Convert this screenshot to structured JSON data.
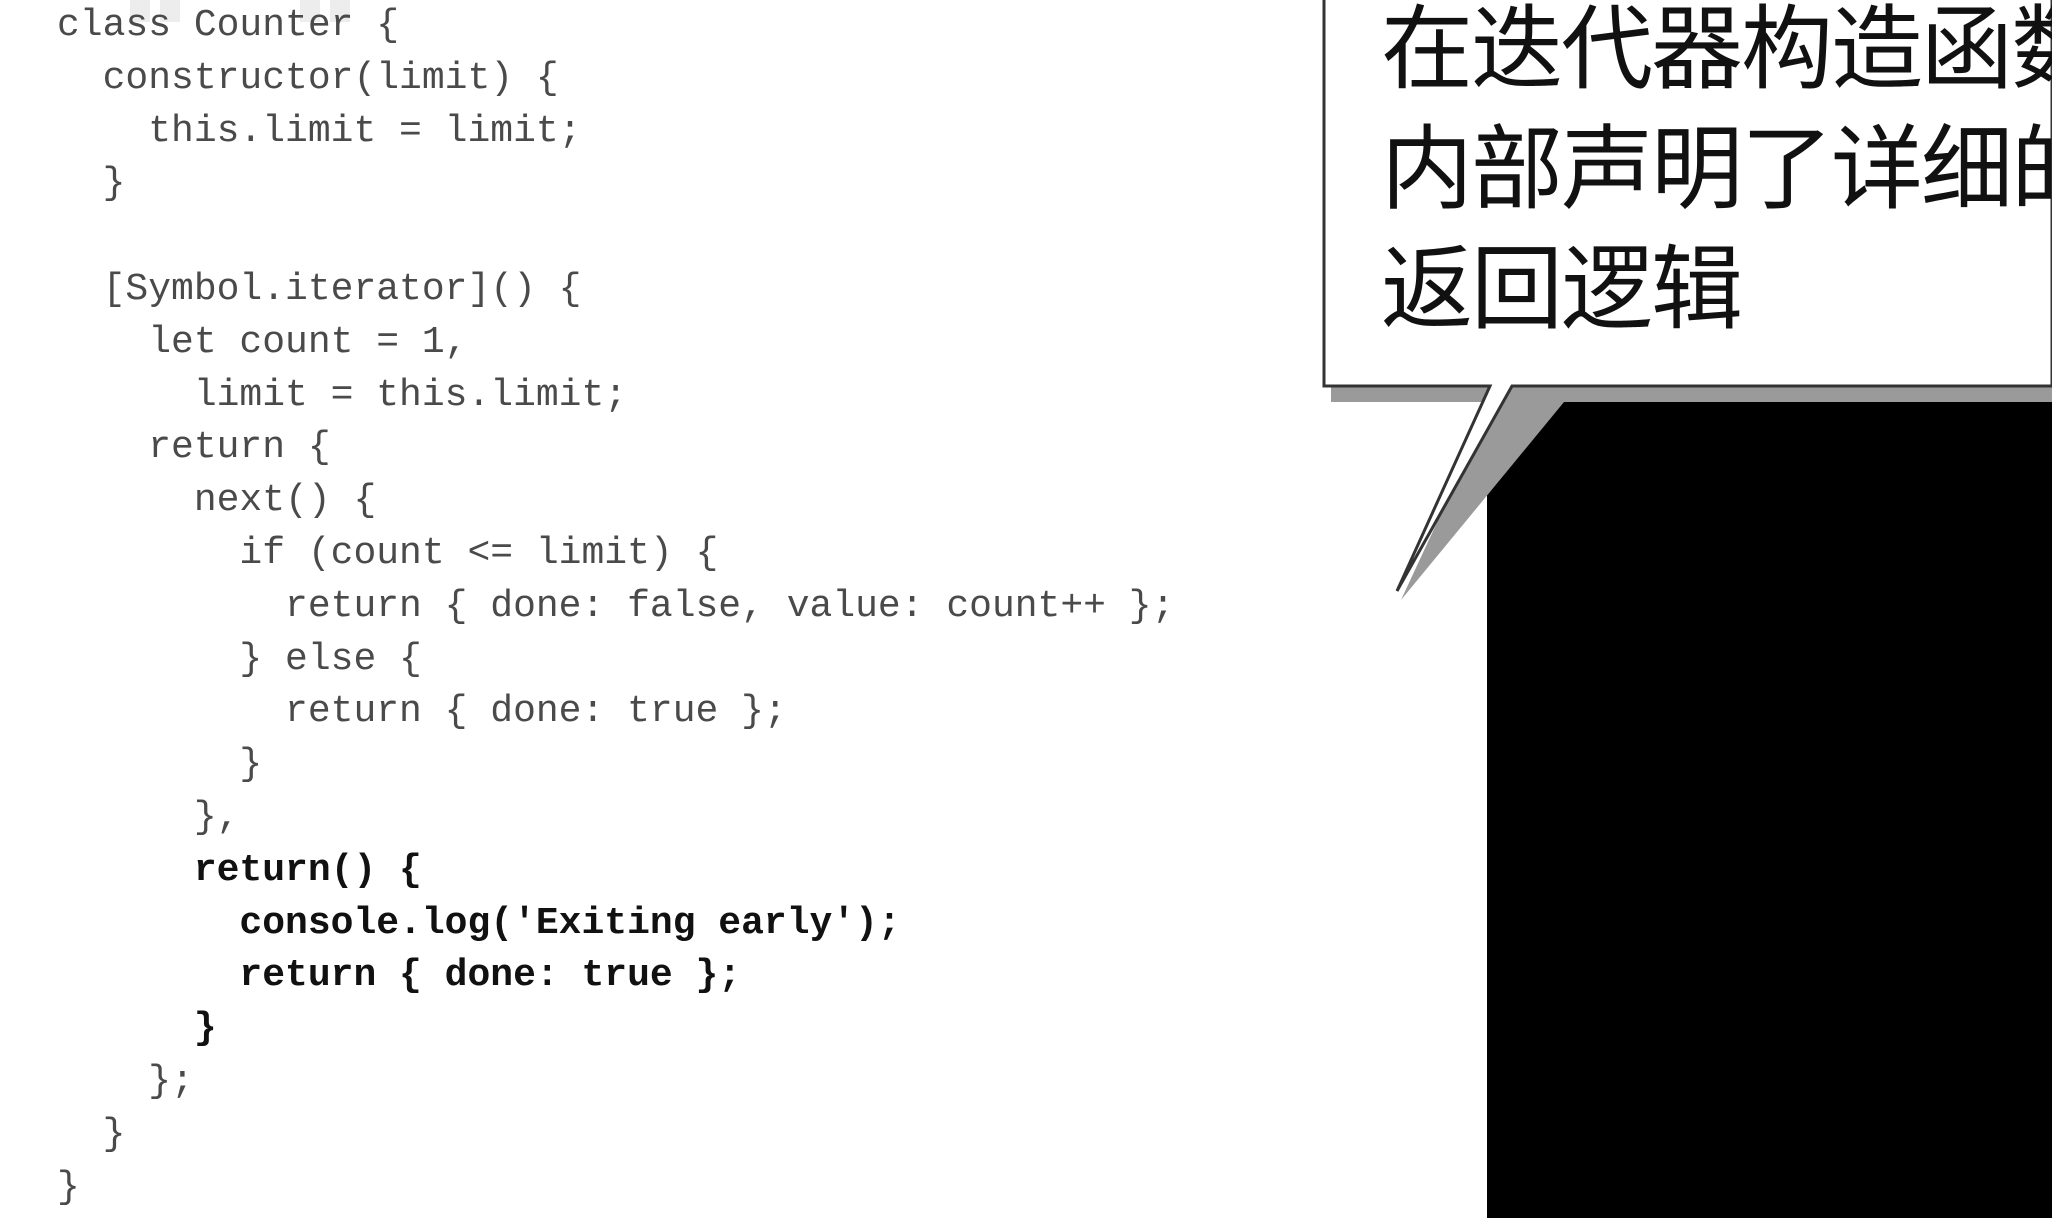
{
  "code": {
    "lines": [
      {
        "text": "class Counter {",
        "bold": false
      },
      {
        "text": "  constructor(limit) {",
        "bold": false
      },
      {
        "text": "    this.limit = limit;",
        "bold": false
      },
      {
        "text": "  }",
        "bold": false
      },
      {
        "text": "",
        "bold": false
      },
      {
        "text": "  [Symbol.iterator]() {",
        "bold": false
      },
      {
        "text": "    let count = 1,",
        "bold": false
      },
      {
        "text": "      limit = this.limit;",
        "bold": false
      },
      {
        "text": "    return {",
        "bold": false
      },
      {
        "text": "      next() {",
        "bold": false
      },
      {
        "text": "        if (count <= limit) {",
        "bold": false
      },
      {
        "text": "          return { done: false, value: count++ };",
        "bold": false
      },
      {
        "text": "        } else {",
        "bold": false
      },
      {
        "text": "          return { done: true };",
        "bold": false
      },
      {
        "text": "        }",
        "bold": false
      },
      {
        "text": "      },",
        "bold": false
      },
      {
        "text": "      return() {",
        "bold": true
      },
      {
        "text": "        console.log('Exiting early');",
        "bold": true
      },
      {
        "text": "        return { done: true };",
        "bold": true
      },
      {
        "text": "      }",
        "bold": true
      },
      {
        "text": "    };",
        "bold": false
      },
      {
        "text": "  }",
        "bold": false
      },
      {
        "text": "}",
        "bold": false
      }
    ]
  },
  "callout": {
    "lines": [
      "在迭代器构造函数",
      "内部声明了详细的",
      "返回逻辑"
    ]
  },
  "colors": {
    "code_text": "#4a4a4a",
    "code_bold": "#111111",
    "background": "#ffffff",
    "panel": "#000000"
  }
}
